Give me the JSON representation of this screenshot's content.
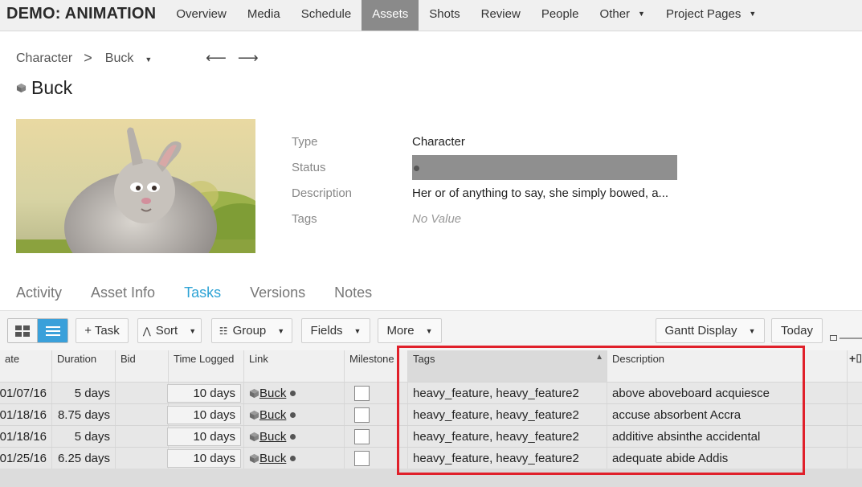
{
  "nav": {
    "project": "DEMO: ANIMATION",
    "items": [
      {
        "label": "Overview"
      },
      {
        "label": "Media"
      },
      {
        "label": "Schedule"
      },
      {
        "label": "Assets",
        "active": true
      },
      {
        "label": "Shots"
      },
      {
        "label": "Review"
      },
      {
        "label": "People"
      },
      {
        "label": "Other",
        "dropdown": true
      },
      {
        "label": "Project Pages",
        "dropdown": true
      }
    ]
  },
  "breadcrumb": {
    "parent": "Character",
    "separator": ">",
    "current": "Buck",
    "prev_icon": "left-arrow-icon",
    "next_icon": "right-arrow-icon"
  },
  "asset": {
    "title": "Buck",
    "fields": [
      {
        "label": "Type",
        "value": "Character"
      },
      {
        "label": "Status",
        "value": ""
      },
      {
        "label": "Description",
        "value": "Her or of anything to say, she simply bowed, a..."
      },
      {
        "label": "Tags",
        "value": "No Value"
      }
    ]
  },
  "tabs": [
    "Activity",
    "Asset Info",
    "Tasks",
    "Versions",
    "Notes"
  ],
  "active_tab": "Tasks",
  "toolbar": {
    "task_label": "+ Task",
    "sort_label": "Sort",
    "group_label": "Group",
    "fields_label": "Fields",
    "more_label": "More",
    "gantt_label": "Gantt Display",
    "today_label": "Today"
  },
  "table": {
    "columns": [
      "ate",
      "Duration",
      "Bid",
      "Time Logged",
      "Link",
      "Milestone",
      "Tags",
      "Description"
    ],
    "rows": [
      {
        "date": "01/07/16",
        "duration": "5 days",
        "bid": "",
        "time_logged": "10 days",
        "link": "Buck",
        "tags": "heavy_feature, heavy_feature2",
        "description": "above aboveboard acquiesce"
      },
      {
        "date": "01/18/16",
        "duration": "8.75 days",
        "bid": "",
        "time_logged": "10 days",
        "link": "Buck",
        "tags": "heavy_feature, heavy_feature2",
        "description": "accuse absorbent Accra"
      },
      {
        "date": "01/18/16",
        "duration": "5 days",
        "bid": "",
        "time_logged": "10 days",
        "link": "Buck",
        "tags": "heavy_feature, heavy_feature2",
        "description": "additive absinthe accidental"
      },
      {
        "date": "01/25/16",
        "duration": "6.25 days",
        "bid": "",
        "time_logged": "10 days",
        "link": "Buck",
        "tags": "heavy_feature, heavy_feature2",
        "description": "adequate abide Addis"
      }
    ]
  },
  "colors": {
    "accent": "#2ea3d5",
    "highlight": "#e0202a",
    "active_nav": "#8a8a8a"
  }
}
